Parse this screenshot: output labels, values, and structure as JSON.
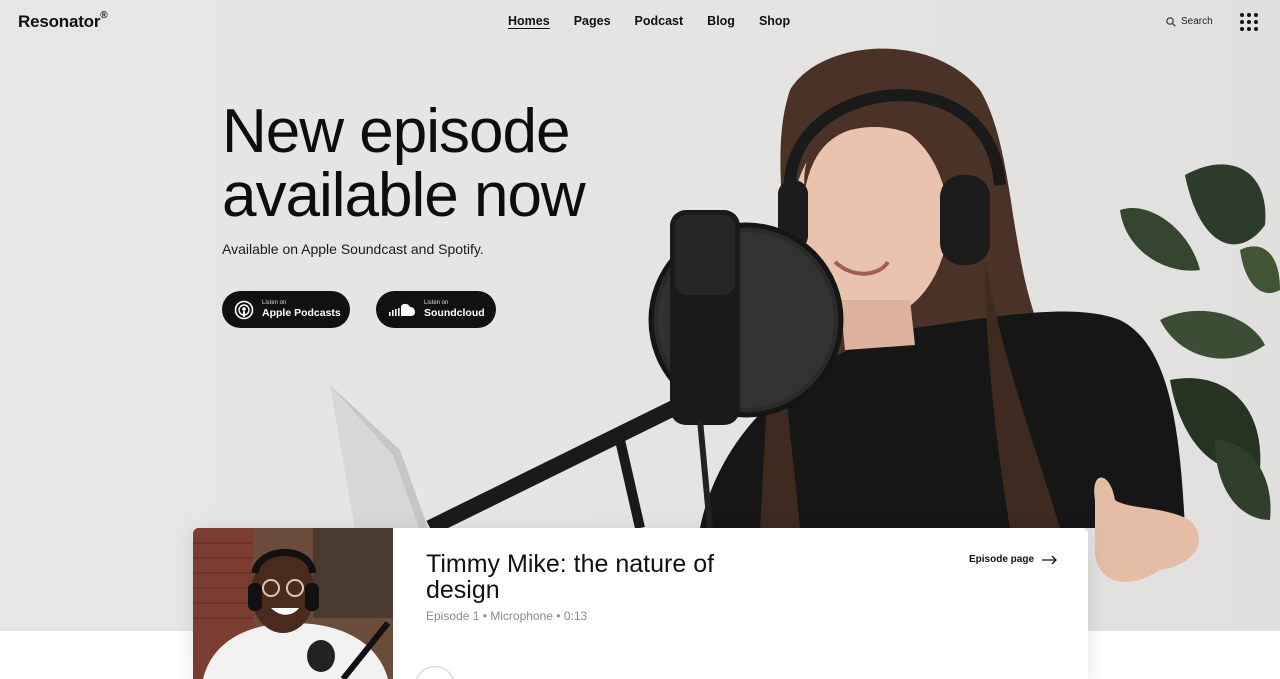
{
  "header": {
    "logo": "Resonator",
    "logo_mark": "®",
    "nav": [
      {
        "label": "Homes",
        "active": true
      },
      {
        "label": "Pages",
        "active": false
      },
      {
        "label": "Podcast",
        "active": false
      },
      {
        "label": "Blog",
        "active": false
      },
      {
        "label": "Shop",
        "active": false
      }
    ],
    "search_label": "Search",
    "search_icon": "search-icon",
    "menu_icon": "grid-dots-icon"
  },
  "hero": {
    "title_line1": "New episode",
    "title_line2": "available now",
    "subtitle": "Available on Apple Soundcast and Spotify.",
    "buttons": [
      {
        "small": "Listen on",
        "big": "Apple Podcasts",
        "icon": "podcast-icon"
      },
      {
        "small": "Listen on",
        "big": "Soundcloud",
        "icon": "soundcloud-icon"
      }
    ]
  },
  "episode": {
    "title": "Timmy Mike: the nature of design",
    "meta": "Episode 1 • Microphone • 0:13",
    "link_label": "Episode page",
    "link_icon": "arrow-right-icon",
    "play_icon": "play-icon"
  },
  "colors": {
    "hero_bg": "#e7e5e4",
    "dark": "#111111",
    "meta_gray": "#8a8a8a"
  }
}
